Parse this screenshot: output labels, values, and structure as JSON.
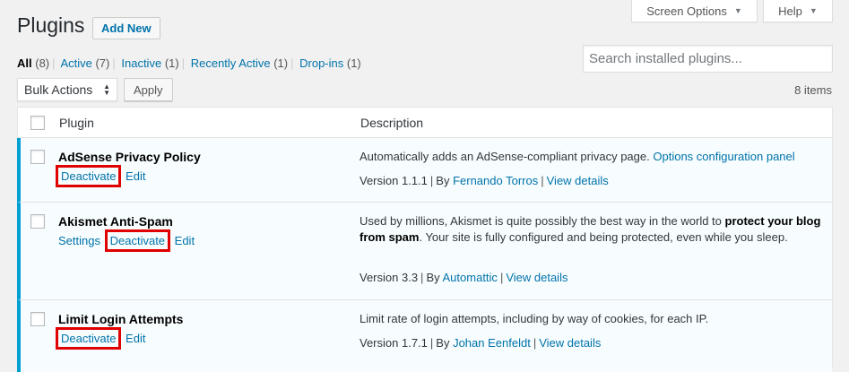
{
  "header": {
    "title": "Plugins",
    "add_new": "Add New",
    "screen_options": "Screen Options",
    "help": "Help"
  },
  "filters": {
    "all": "All",
    "all_count": "(8)",
    "active": "Active",
    "active_count": "(7)",
    "inactive": "Inactive",
    "inactive_count": "(1)",
    "recently_active": "Recently Active",
    "recently_active_count": "(1)",
    "dropins": "Drop-ins",
    "dropins_count": "(1)",
    "separator": "|"
  },
  "search": {
    "placeholder": "Search installed plugins..."
  },
  "bulk": {
    "label": "Bulk Actions",
    "apply": "Apply"
  },
  "items_count": "8 items",
  "table": {
    "col_plugin": "Plugin",
    "col_description": "Description",
    "rows": [
      {
        "name": "AdSense Privacy Policy",
        "actions": [
          "Deactivate",
          "Edit"
        ],
        "description": "Automatically adds an AdSense-compliant privacy page.",
        "desc_link": "Options configuration panel",
        "version": "Version 1.1.1",
        "by": "By",
        "author": "Fernando Torros",
        "details": "View details"
      },
      {
        "name": "Akismet Anti-Spam",
        "actions": [
          "Settings",
          "Deactivate",
          "Edit"
        ],
        "description_pre": "Used by millions, Akismet is quite possibly the best way in the world to",
        "description_bold": "protect your blog from spam",
        "description_post": ". Your site is fully configured and being protected, even while you sleep.",
        "version": "Version 3.3",
        "by": "By",
        "author": "Automattic",
        "details": "View details"
      },
      {
        "name": "Limit Login Attempts",
        "actions": [
          "Deactivate",
          "Edit"
        ],
        "description": "Limit rate of login attempts, including by way of cookies, for each IP.",
        "version": "Version 1.7.1",
        "by": "By",
        "author": "Johan Eenfeldt",
        "details": "View details"
      }
    ]
  },
  "colors": {
    "accent": "#0073aa",
    "active_border": "#00a0d2",
    "highlight": "#e00000"
  }
}
